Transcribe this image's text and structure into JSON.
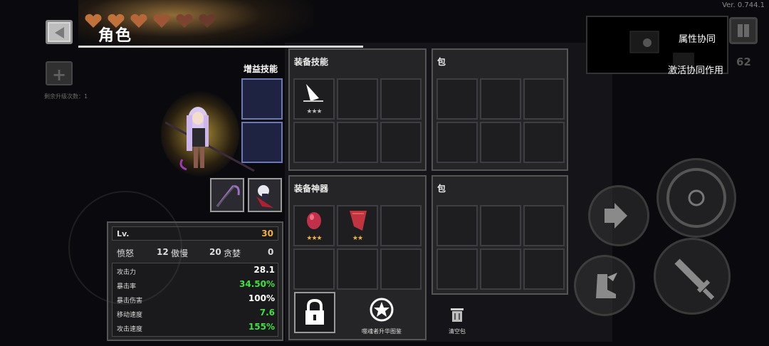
{
  "version": "Ver. 0.744.1",
  "header": {
    "title": "角色",
    "hearts_count": 6
  },
  "upgrade_count_label": "剩余升级次数：1",
  "buff_skills": {
    "label": "增益技能"
  },
  "equip_skills": {
    "title": "装备技能",
    "items": [
      {
        "icon": "sword-slash-icon",
        "stars": "★★★"
      }
    ]
  },
  "bag1": {
    "title": "包"
  },
  "equip_artifacts": {
    "title": "装备神器",
    "items": [
      {
        "icon": "red-gem-icon",
        "stars": "★★★"
      },
      {
        "icon": "red-cape-icon",
        "stars": "★★"
      }
    ]
  },
  "bag2": {
    "title": "包"
  },
  "stats": {
    "lv_label": "Lv.",
    "lv_value": "30",
    "sins": [
      {
        "name": "愤怒",
        "value": "12"
      },
      {
        "name": "傲慢",
        "value": "20"
      },
      {
        "name": "贪婪",
        "value": "0"
      }
    ],
    "attributes": [
      {
        "name": "攻击力",
        "value": "28.1",
        "color": "#ffffff"
      },
      {
        "name": "暴击率",
        "value": "34.50%",
        "color": "#3fe03f"
      },
      {
        "name": "暴击伤害",
        "value": "100%",
        "color": "#ffffff"
      },
      {
        "name": "移动速度",
        "value": "7.6",
        "color": "#3fe03f"
      },
      {
        "name": "攻击速度",
        "value": "155%",
        "color": "#3fe03f"
      }
    ]
  },
  "actions": {
    "codex_label": "噬魂者升华图鉴",
    "clear_bag_label": "清空包"
  },
  "synergy": {
    "attribute_label": "属性协同",
    "activate_label": "激活协同作用"
  },
  "coins": "62",
  "colors": {
    "star_silver": "#b9b9b9",
    "star_gold": "#f2b03a",
    "green_stat": "#3fe03f",
    "level_gold": "#f2b03a"
  }
}
